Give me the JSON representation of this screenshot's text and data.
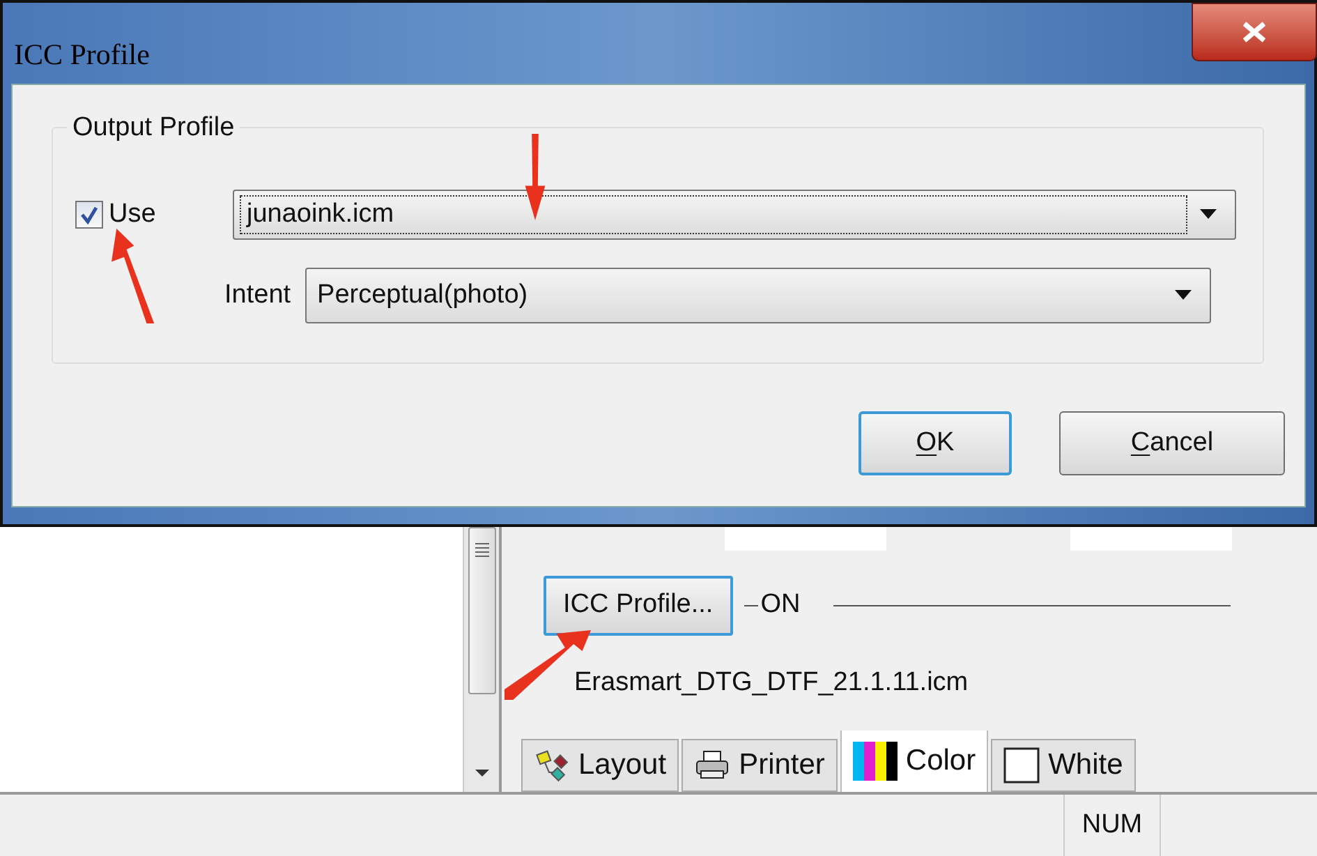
{
  "dialog": {
    "title": "ICC Profile",
    "group": {
      "label": "Output Profile",
      "use_checkbox": {
        "label": "Use",
        "checked": true
      },
      "profile_combo": {
        "value": "junaoink.icm",
        "focused": true
      },
      "intent": {
        "label": "Intent",
        "value": "Perceptual(photo)"
      }
    },
    "buttons": [
      {
        "label": "OK",
        "default": true
      },
      {
        "label": "Cancel",
        "default": false
      }
    ]
  },
  "background": {
    "icc_button": "ICC Profile...",
    "icc_state": "ON",
    "profile_file": "Erasmart_DTG_DTF_21.1.11.icm",
    "tabs": [
      {
        "label": "Layout",
        "kind": "layout",
        "selected": false
      },
      {
        "label": "Printer",
        "kind": "printer",
        "selected": false
      },
      {
        "label": "Color",
        "kind": "color",
        "selected": true
      },
      {
        "label": "White",
        "kind": "white",
        "selected": false
      }
    ],
    "status_bar": {
      "num": "NUM"
    }
  }
}
